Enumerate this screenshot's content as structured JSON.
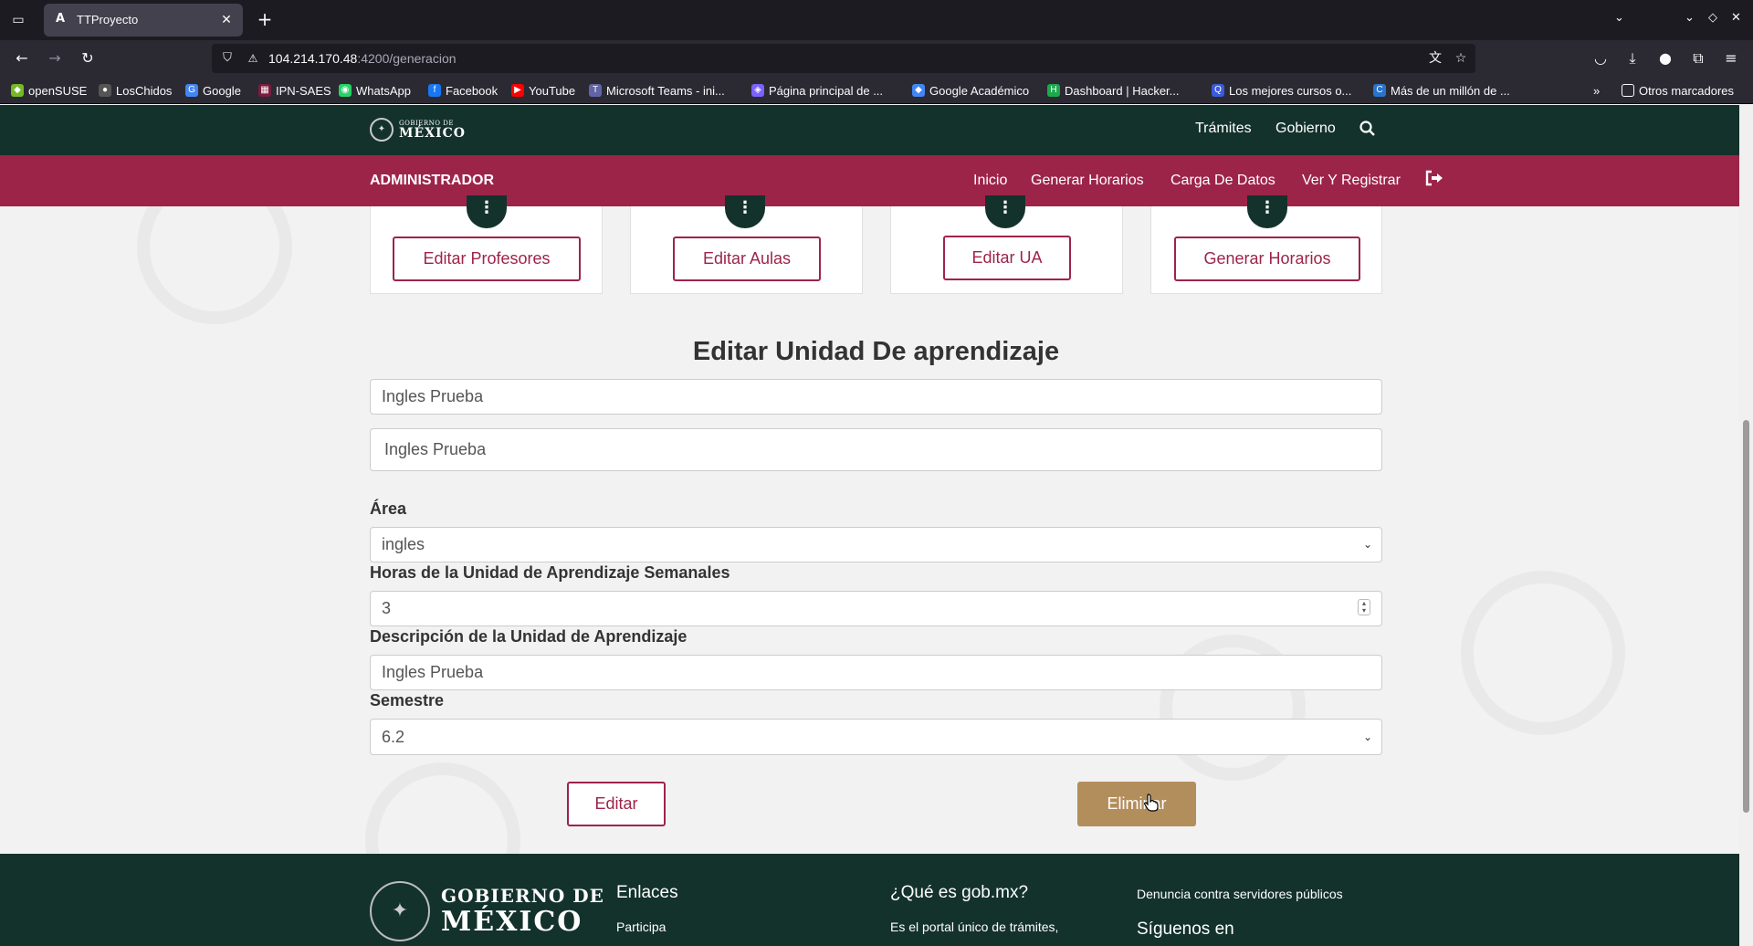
{
  "browser": {
    "tab_title": "TTProyecto",
    "tab_favicon": "A",
    "url_host": "104.214.170.48",
    "url_rest": ":4200/generacion",
    "bookmarks": [
      {
        "label": "openSUSE",
        "icon": "opensuse-icon",
        "color": "#73ba25"
      },
      {
        "label": "LosChidos",
        "icon": "github-icon",
        "color": "#555555"
      },
      {
        "label": "Google",
        "icon": "google-icon",
        "color": "#4285f4"
      },
      {
        "label": "IPN-SAES",
        "icon": "saes-icon",
        "color": "#7a1c3e"
      },
      {
        "label": "WhatsApp",
        "icon": "whatsapp-icon",
        "color": "#25d366"
      },
      {
        "label": "Facebook",
        "icon": "facebook-icon",
        "color": "#1877f2"
      },
      {
        "label": "YouTube",
        "icon": "youtube-icon",
        "color": "#ff0000"
      },
      {
        "label": "Microsoft Teams - ini...",
        "icon": "teams-icon",
        "color": "#6264a7"
      },
      {
        "label": "Página principal de ...",
        "icon": "page-icon",
        "color": "#7b61ff"
      },
      {
        "label": "Google Académico",
        "icon": "scholar-icon",
        "color": "#4285f4"
      },
      {
        "label": "Dashboard | Hacker...",
        "icon": "hackerrank-icon",
        "color": "#1ba94c"
      },
      {
        "label": "Los mejores cursos o...",
        "icon": "courses-icon",
        "color": "#3b5bdb"
      },
      {
        "label": "Más de un millón de ...",
        "icon": "coursera-icon",
        "color": "#2a73cc"
      }
    ],
    "other_bookmarks": "Otros marcadores"
  },
  "gob_header": {
    "logo_small": "GOBIERNO DE",
    "logo_big": "MÉXICO",
    "tramites": "Trámites",
    "gobierno": "Gobierno"
  },
  "admin_bar": {
    "brand": "ADMINISTRADOR",
    "nav": [
      "Inicio",
      "Generar Horarios",
      "Carga De Datos",
      "Ver Y Registrar"
    ]
  },
  "cards": [
    {
      "button": "Editar Profesores"
    },
    {
      "button": "Editar Aulas"
    },
    {
      "button": "Editar UA"
    },
    {
      "button": "Generar Horarios"
    }
  ],
  "form": {
    "title": "Editar Unidad De aprendizaje",
    "field1_value": "Ingles Prueba",
    "field2_value": "Ingles Prueba",
    "area_label": "Área",
    "area_value": "ingles",
    "horas_label": "Horas de la Unidad de Aprendizaje Semanales",
    "horas_value": "3",
    "descripcion_label": "Descripción de la Unidad de Aprendizaje",
    "descripcion_value": "Ingles Prueba",
    "semestre_label": "Semestre",
    "semestre_value": "6.2",
    "editar_button": "Editar",
    "eliminar_button": "Eliminar"
  },
  "footer": {
    "logo_line1": "GOBIERNO DE",
    "logo_line2": "MÉXICO",
    "enlaces": "Enlaces",
    "participa": "Participa",
    "que_es": "¿Qué es gob.mx?",
    "que_es_text": "Es el portal único de trámites,",
    "denuncia": "Denuncia contra servidores públicos",
    "siguenos": "Síguenos en"
  },
  "colors": {
    "gob_green": "#13322b",
    "gob_maroon": "#9d2449",
    "gob_gold": "#b38e5d"
  }
}
